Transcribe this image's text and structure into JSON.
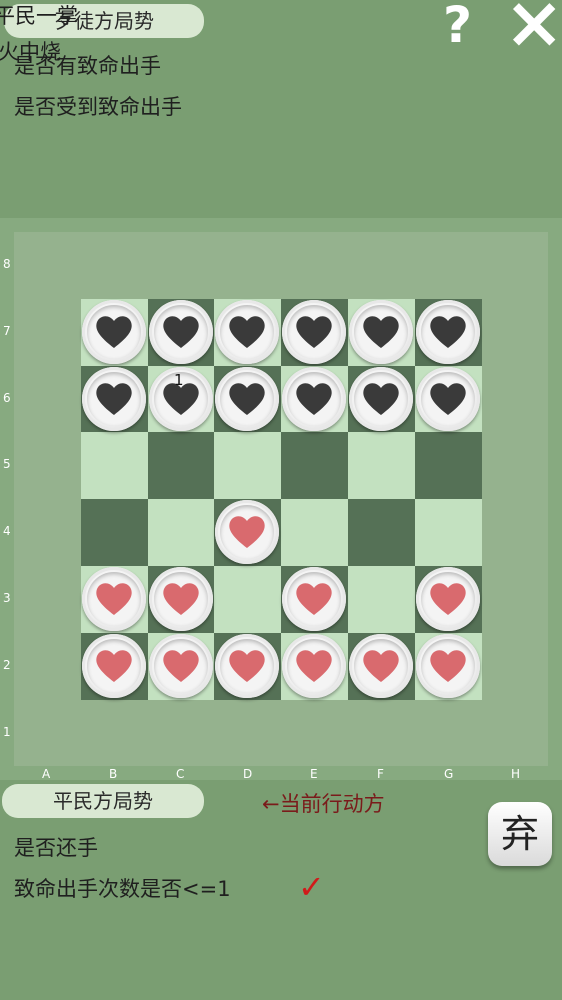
{
  "top_panel": {
    "side_label": "歹徒方局势",
    "overlap_line1": "平民一掌",
    "overlap_line2": "火中烧",
    "status1": "是否有致命出手",
    "status2": "是否受到致命出手",
    "help_label": "?",
    "close_label": "×"
  },
  "board": {
    "ranks": [
      "8",
      "7",
      "6",
      "5",
      "4",
      "3",
      "2",
      "1"
    ],
    "files": [
      "A",
      "B",
      "C",
      "D",
      "E",
      "F",
      "G",
      "H"
    ],
    "piece_number": "1",
    "dark_piece_color": "#3a3a3a",
    "light_piece_color": "#d96a6e"
  },
  "bottom_panel": {
    "side_label": "平民方局势",
    "turn_label": "←当前行动方",
    "status1": "是否还手",
    "status2": "致命出手次数是否<=1",
    "check_mark": "✓",
    "discard_label": "弃"
  }
}
